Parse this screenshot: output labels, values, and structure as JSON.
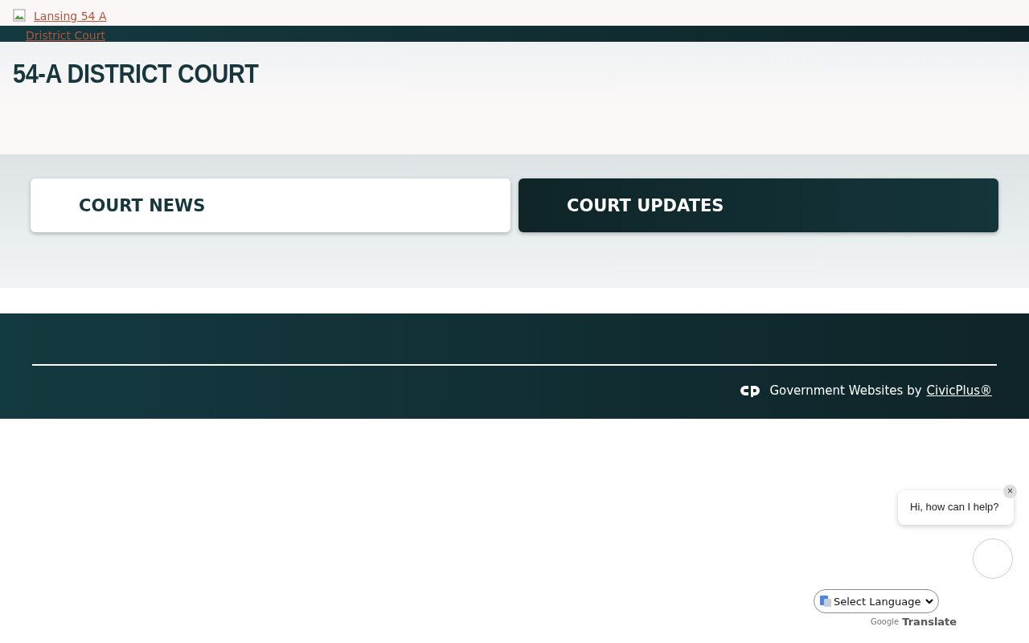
{
  "logo": {
    "text": "Lansing 54 A Dristrict Court"
  },
  "page_title": "54-A DISTRICT COURT",
  "cards": [
    {
      "label": "COURT NEWS",
      "selected": false
    },
    {
      "label": "COURT UPDATES",
      "selected": true
    }
  ],
  "footer": {
    "credit": "Government Websites by",
    "link": "CivicPlus®"
  },
  "chat": {
    "greeting": "Hi, how can I help?",
    "close": "×"
  },
  "translate": {
    "select": "Select Language",
    "brand": "Google",
    "label": "Translate"
  }
}
